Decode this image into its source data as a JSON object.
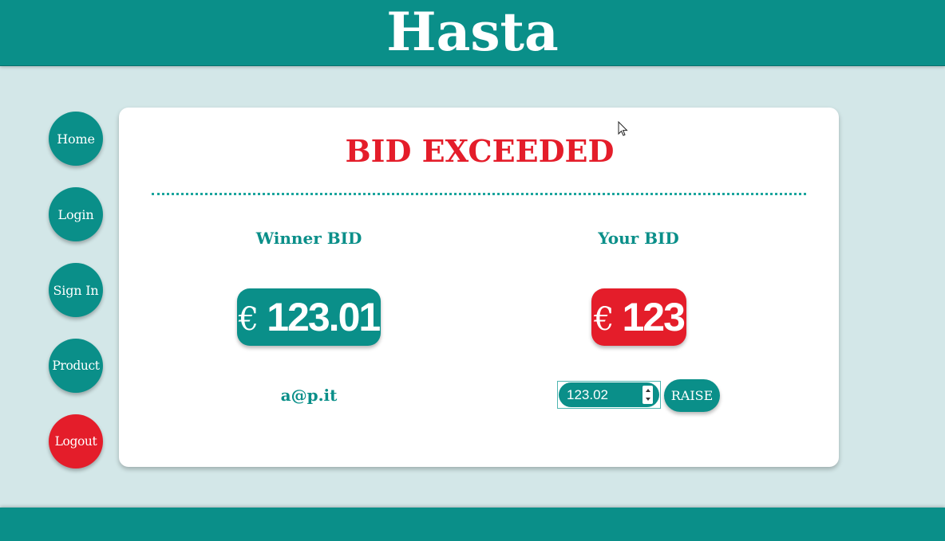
{
  "header": {
    "title": "Hasta"
  },
  "nav": {
    "items": [
      {
        "label": "Home"
      },
      {
        "label": "Login"
      },
      {
        "label": "Sign In"
      },
      {
        "label": "Product"
      },
      {
        "label": "Logout"
      }
    ]
  },
  "card": {
    "title": "BID EXCEEDED",
    "winner": {
      "label": "Winner BID",
      "currency": "€",
      "amount": "123.01",
      "email": "a@p.it"
    },
    "yours": {
      "label": "Your BID",
      "currency": "€",
      "amount": "123",
      "input_value": "123.02",
      "raise_label": "RAISE"
    }
  },
  "colors": {
    "primary": "#0a8f89",
    "accent": "#e41d2a",
    "background": "#d3e7e8"
  }
}
